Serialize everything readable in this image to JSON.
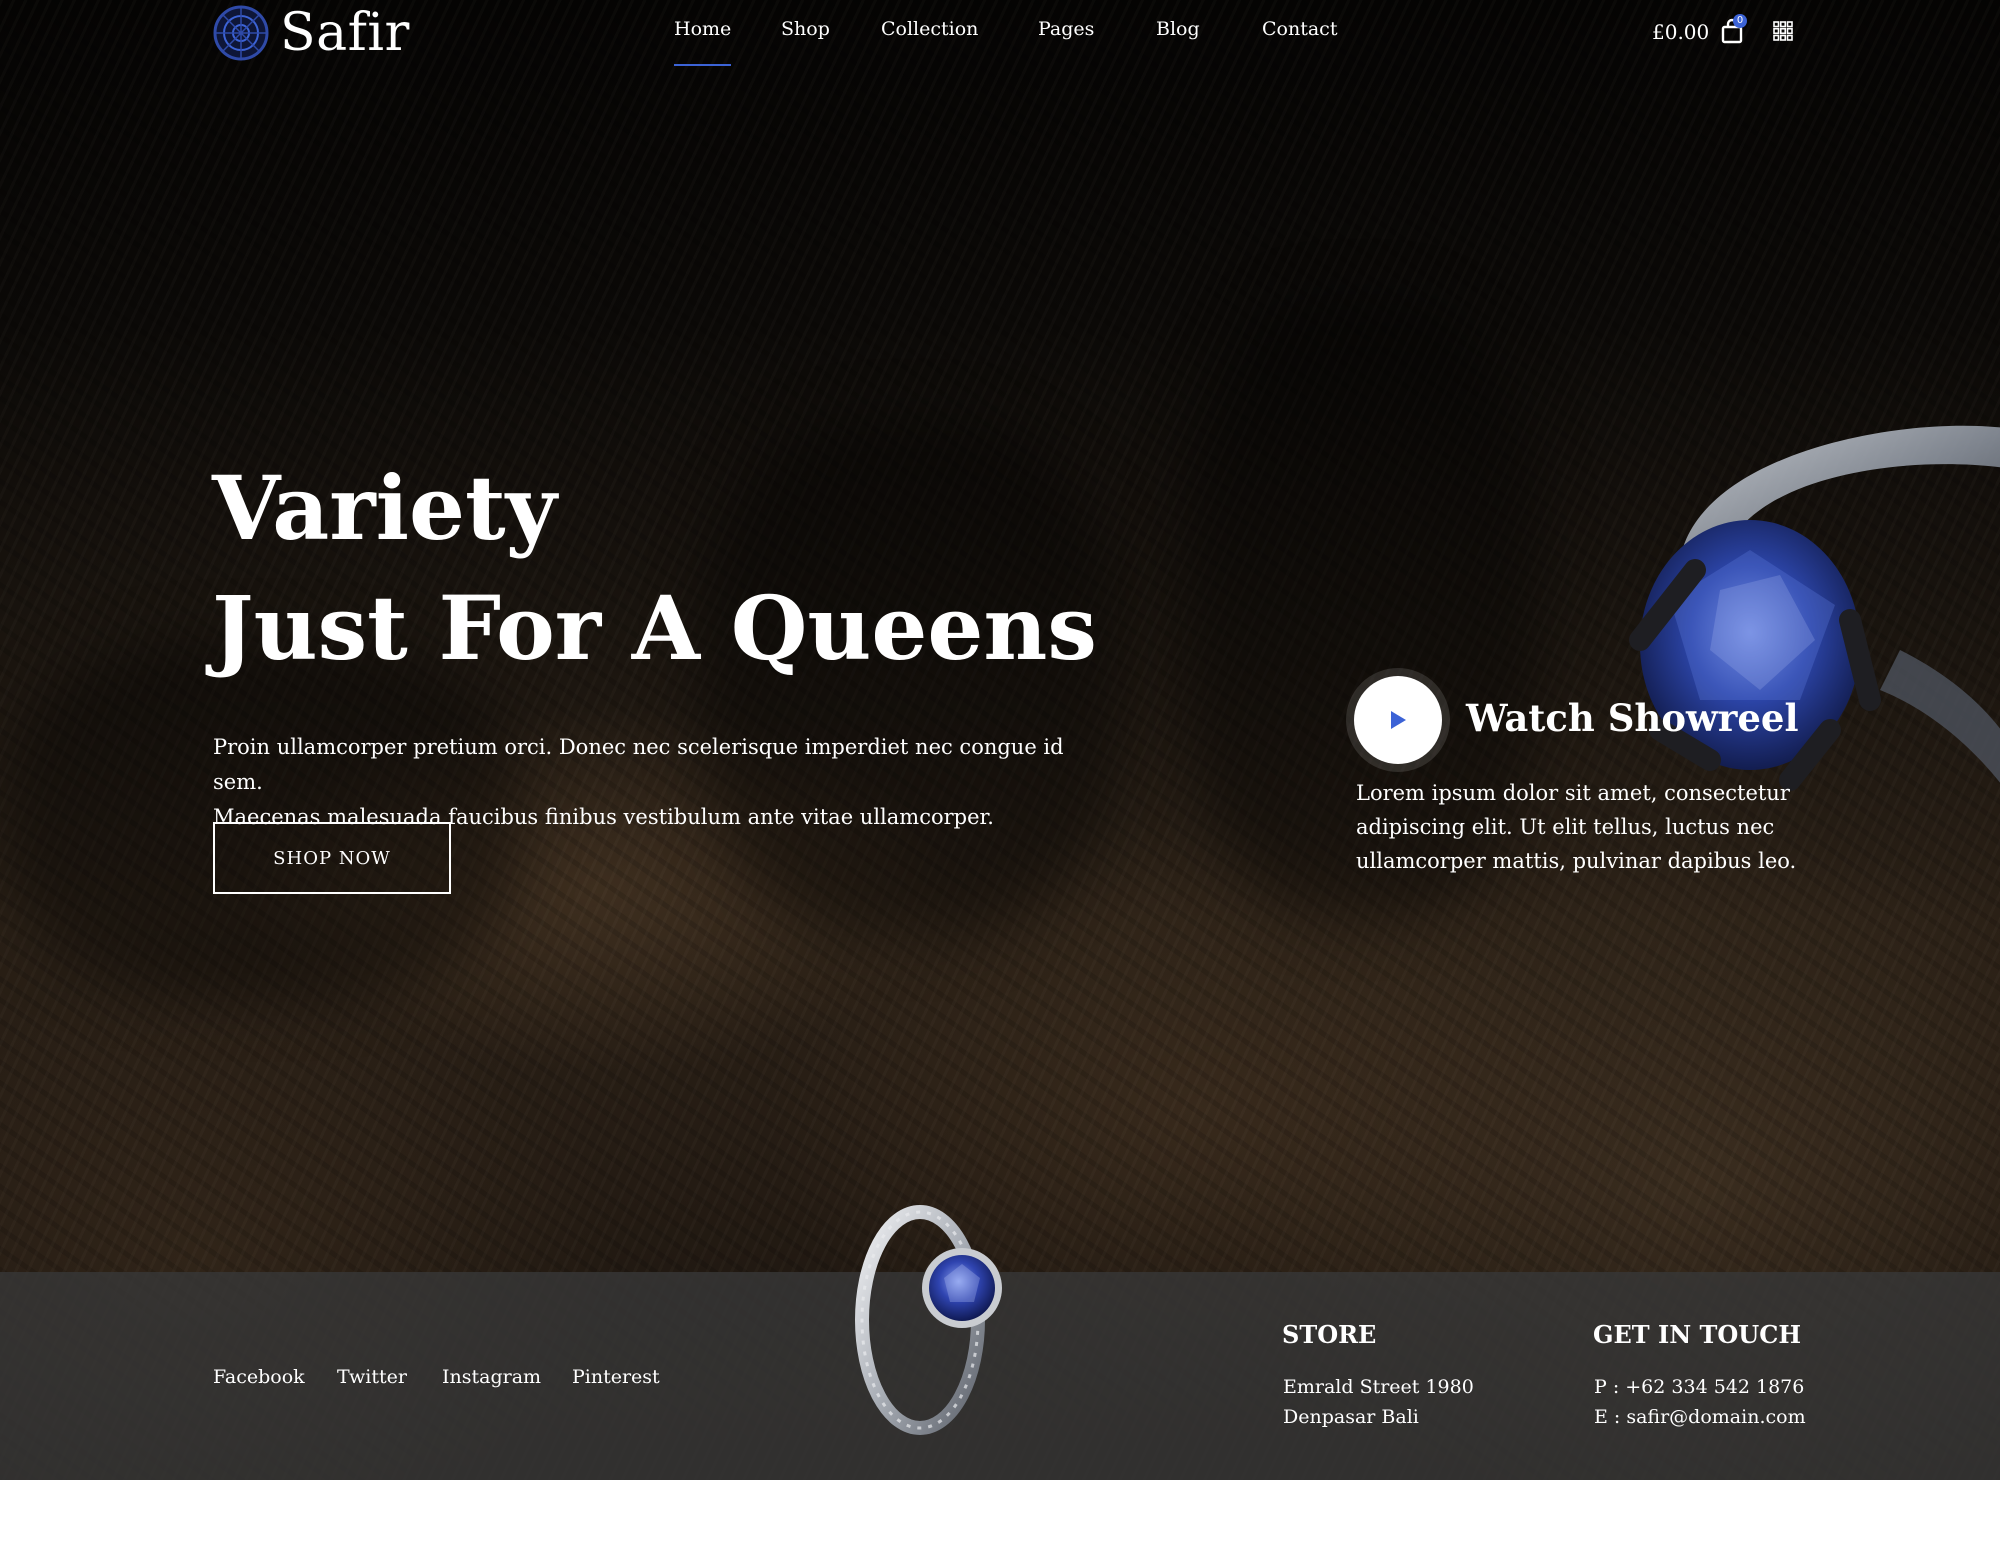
{
  "brand": {
    "name": "Safir"
  },
  "nav": {
    "items": [
      {
        "label": "Home",
        "active": true
      },
      {
        "label": "Shop"
      },
      {
        "label": "Collection"
      },
      {
        "label": "Pages"
      },
      {
        "label": "Blog"
      },
      {
        "label": "Contact"
      }
    ]
  },
  "cart": {
    "total": "£0.00",
    "count": "0"
  },
  "hero": {
    "title_line1": "Variety",
    "title_line2": "Just For A Queens",
    "description_line1": "Proin ullamcorper pretium orci. Donec nec scelerisque imperdiet nec congue id sem.",
    "description_line2": "Maecenas malesuada faucibus finibus vestibulum ante vitae ullamcorper.",
    "cta_label": "SHOP NOW"
  },
  "showreel": {
    "title": "Watch Showreel",
    "description_line1": "Lorem ipsum dolor sit amet, consectetur",
    "description_line2": "adipiscing elit. Ut elit tellus, luctus nec",
    "description_line3": "ullamcorper mattis, pulvinar dapibus leo."
  },
  "footer": {
    "social": [
      "Facebook",
      "Twitter",
      "Instagram",
      "Pinterest"
    ],
    "store": {
      "heading": "STORE",
      "line1": "Emrald Street 1980",
      "line2": "Denpasar Bali"
    },
    "contact": {
      "heading": "GET IN TOUCH",
      "phone": "P : +62 334 542 1876",
      "email": "E : safir@domain.com"
    }
  },
  "colors": {
    "accent": "#3c63d6",
    "text": "#ffffff",
    "footer_strip": "#373737"
  },
  "icons": [
    "logo-mark-icon",
    "cart-bag-icon",
    "grid-menu-icon",
    "play-icon"
  ]
}
